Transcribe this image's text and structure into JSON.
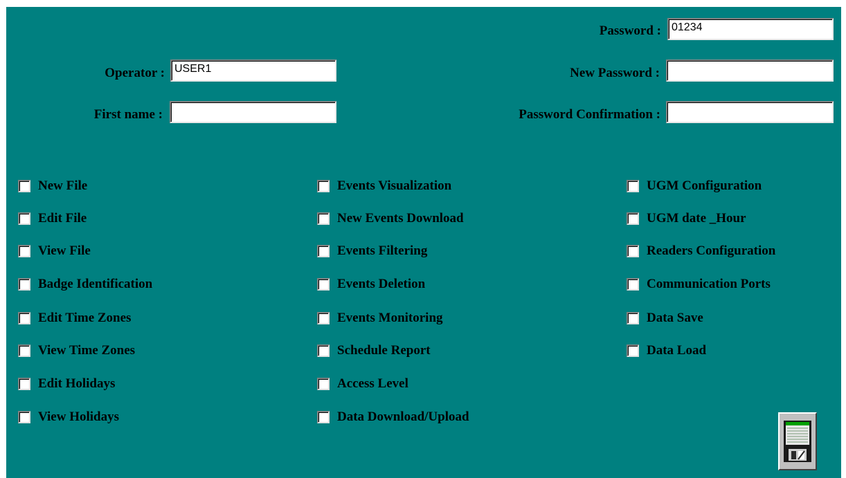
{
  "form": {
    "password_label": "Password :",
    "password_value": "01234",
    "operator_label": "Operator :",
    "operator_value": "USER1",
    "new_password_label": "New Password :",
    "new_password_value": "",
    "first_name_label": "First name :",
    "first_name_value": "",
    "password_confirmation_label": "Password Confirmation :",
    "password_confirmation_value": ""
  },
  "permissions": {
    "col1": [
      "New File",
      "Edit File",
      "View File",
      "Badge Identification",
      "Edit Time Zones",
      "View Time Zones",
      "Edit Holidays",
      "View Holidays"
    ],
    "col2": [
      "Events Visualization",
      "New Events Download",
      "Events Filtering",
      "Events Deletion",
      "Events Monitoring",
      "Schedule Report",
      "Access Level",
      "Data Download/Upload"
    ],
    "col3": [
      "UGM Configuration",
      "UGM date _Hour",
      "Readers Configuration",
      "Communication Ports",
      "Data Save",
      "Data Load"
    ]
  },
  "icons": {
    "save": "floppy-disk-icon"
  },
  "colors": {
    "background": "#008080"
  }
}
